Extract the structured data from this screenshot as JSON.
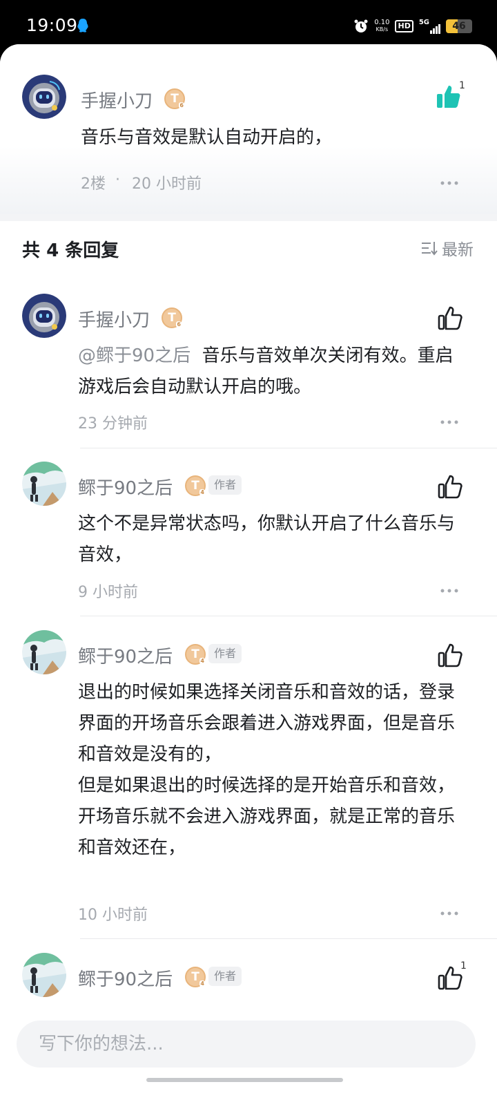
{
  "status_bar": {
    "time": "19:09",
    "net_speed_value": "0.10",
    "net_speed_unit": "KB/s",
    "hd": "HD",
    "network": "5G",
    "battery": "46",
    "battery_level": 0.46
  },
  "main_comment": {
    "username": "手握小刀",
    "badge": "T",
    "badge_level": "6",
    "content": "音乐与音效是默认自动开启的，",
    "floor": "2楼",
    "separator": "·",
    "time": "20 小时前",
    "like_count": "1",
    "liked": true
  },
  "replies_header": {
    "prefix": "共",
    "count": "4",
    "suffix": "条回复",
    "sort_label": "最新"
  },
  "replies": [
    {
      "username": "手握小刀",
      "badge": "T",
      "badge_level": "6",
      "mention": "@鳏于90之后",
      "content": "  音乐与音效单次关闭有效。重启游戏后会自动默认开启的哦。",
      "time": "23 分钟前"
    },
    {
      "username": "鳏于90之后",
      "badge": "T",
      "badge_level": "4",
      "author_tag": "作者",
      "content": "这个不是异常状态吗，你默认开启了什么音乐与音效，",
      "time": "9 小时前"
    },
    {
      "username": "鳏于90之后",
      "badge": "T",
      "badge_level": "4",
      "author_tag": "作者",
      "content": "退出的时候如果选择关闭音乐和音效的话，登录界面的开场音乐会跟着进入游戏界面，但是音乐和音效是没有的，\n但是如果退出的时候选择的是开始音乐和音效，开场音乐就不会进入游戏界面，就是正常的音乐和音效还在，",
      "time": "10 小时前"
    },
    {
      "username": "鳏于90之后",
      "badge": "T",
      "badge_level": "4",
      "author_tag": "作者",
      "like_count": "1"
    }
  ],
  "input": {
    "placeholder": "写下你的想法..."
  },
  "colors": {
    "accent_like": "#1ec3b4",
    "badge": "#f1c89b"
  }
}
